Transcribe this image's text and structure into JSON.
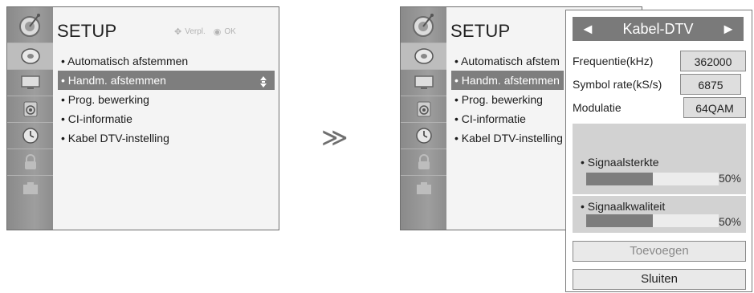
{
  "left_menu": {
    "title": "SETUP",
    "hint": {
      "move_label": "Verpl.",
      "ok_label": "OK"
    },
    "items": [
      "• Automatisch afstemmen",
      "• Handm. afstemmen",
      "• Prog. bewerking",
      "• CI-informatie",
      "• Kabel DTV-instelling"
    ],
    "selected_index": 1
  },
  "separator": "≫",
  "right_menu": {
    "title": "SETUP",
    "items": [
      "• Automatisch afstem",
      "• Handm. afstemmen",
      "• Prog. bewerking",
      "• CI-informatie",
      "• Kabel DTV-instelling"
    ]
  },
  "popup": {
    "mode_left": "◄",
    "mode_label": "Kabel-DTV",
    "mode_right": "►",
    "fields": [
      {
        "label": "Frequentie(kHz)",
        "value": "362000"
      },
      {
        "label": "Symbol rate(kS/s)",
        "value": "6875"
      },
      {
        "label": "Modulatie",
        "value": "64QAM"
      }
    ],
    "signal_strength": {
      "label": "• Signaalsterkte",
      "percent": "50%",
      "level": 0.5
    },
    "signal_quality": {
      "label": "• Signaalkwaliteit",
      "percent": "50%",
      "level": 0.5
    },
    "add_button": "Toevoegen",
    "close_button": "Sluiten"
  },
  "icons": [
    "dish-icon",
    "disc-icon",
    "monitor-icon",
    "speaker-icon",
    "clock-icon",
    "lock-icon",
    "input-icon"
  ]
}
